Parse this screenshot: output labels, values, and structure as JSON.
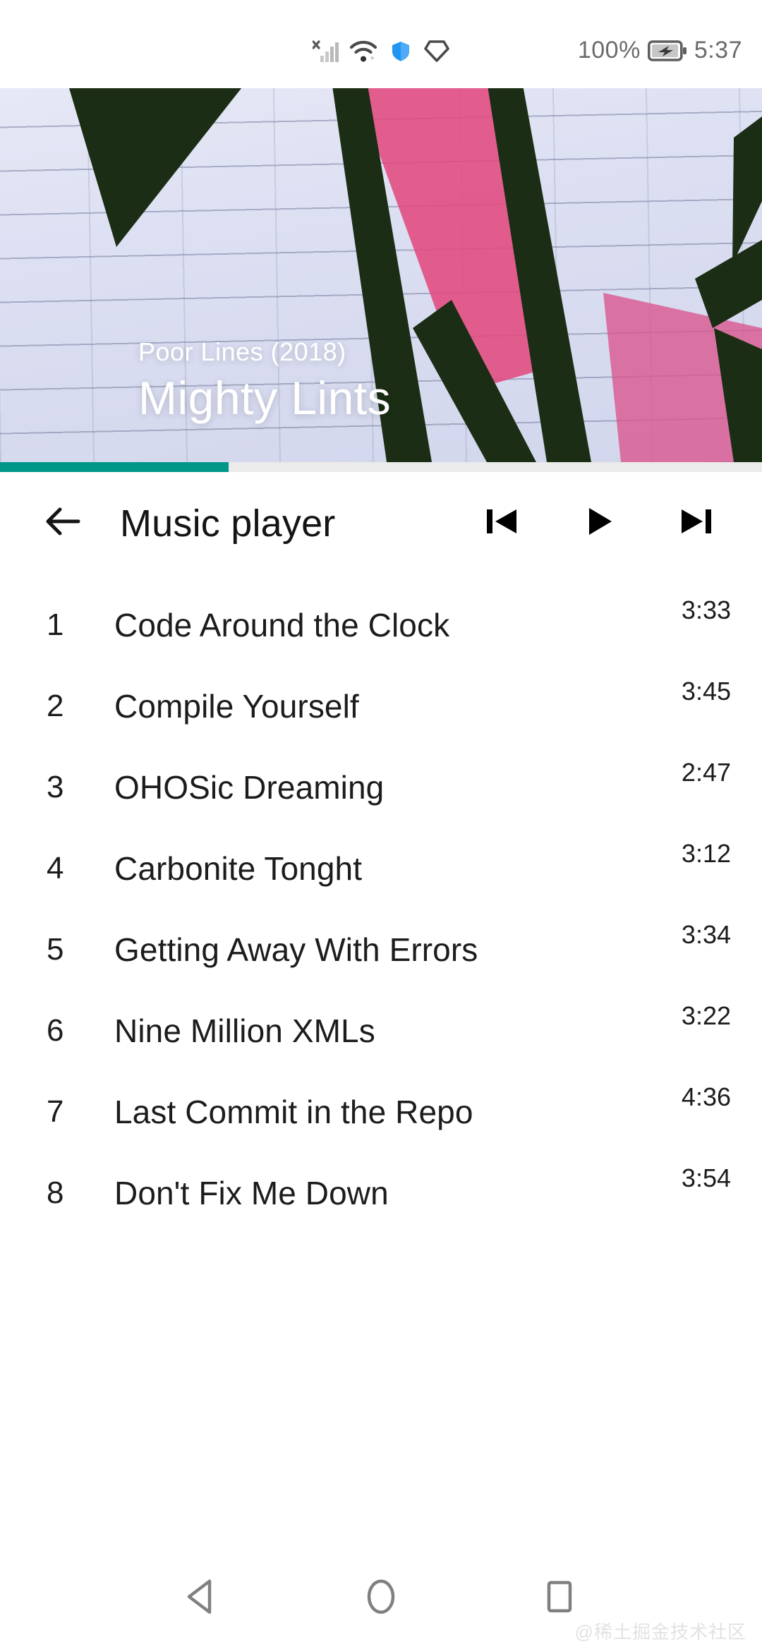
{
  "status_bar": {
    "icons": [
      "signal-no-sim-icon",
      "wifi-icon",
      "shield-icon",
      "gem-icon"
    ],
    "battery_percent": "100%",
    "battery_state": "charging",
    "time": "5:37"
  },
  "album": {
    "subtitle": "Poor Lines (2018)",
    "title": "Mighty Lints",
    "art_colors": {
      "wall": "#dfe2f2",
      "stripe_dark": "#1b2e15",
      "paint_pink": "#e14a7e"
    }
  },
  "progress": {
    "percent": 30,
    "fill_color": "#009688",
    "track_color": "#ebebeb"
  },
  "toolbar": {
    "back_label": "←",
    "title": "Music player",
    "controls": [
      {
        "name": "previous",
        "glyph": "skip-previous-icon"
      },
      {
        "name": "play",
        "glyph": "play-icon"
      },
      {
        "name": "next",
        "glyph": "skip-next-icon"
      }
    ]
  },
  "tracks": [
    {
      "num": "1",
      "title": "Code Around the Clock",
      "duration": "3:33"
    },
    {
      "num": "2",
      "title": "Compile Yourself",
      "duration": "3:45"
    },
    {
      "num": "3",
      "title": "OHOSic Dreaming",
      "duration": "2:47"
    },
    {
      "num": "4",
      "title": "Carbonite Tonght",
      "duration": "3:12"
    },
    {
      "num": "5",
      "title": "Getting Away With Errors",
      "duration": "3:34"
    },
    {
      "num": "6",
      "title": "Nine Million XMLs",
      "duration": "3:22"
    },
    {
      "num": "7",
      "title": "Last Commit in the Repo",
      "duration": "4:36"
    },
    {
      "num": "8",
      "title": "Don't Fix Me Down",
      "duration": "3:54"
    }
  ],
  "navbar": {
    "back": "back-triangle-icon",
    "home": "home-circle-icon",
    "recents": "recents-square-icon"
  },
  "watermark": "@稀土掘金技术社区"
}
